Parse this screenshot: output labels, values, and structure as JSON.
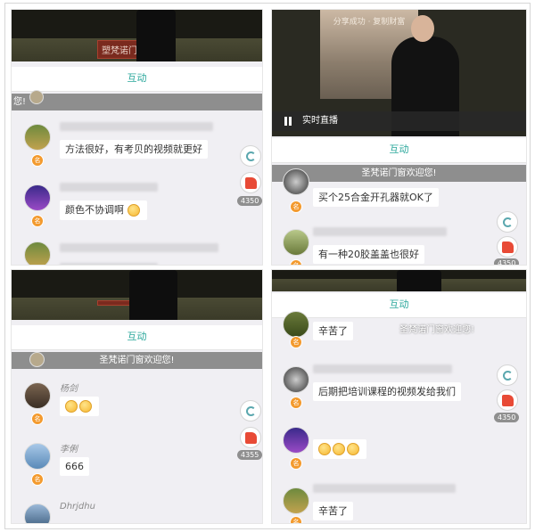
{
  "colors": {
    "accent": "#2aa79b",
    "banner": "#8e8e8e",
    "like": "#e84a36",
    "badge": "#f39a2e"
  },
  "icons": [
    "refresh-icon",
    "thumb-up-icon",
    "pause-icon"
  ],
  "panels": {
    "tl": {
      "tab": "互动",
      "banner": "您!",
      "sign": "塑梵诺门",
      "likes": "4350",
      "messages": [
        {
          "text": "方法很好，有考贝的视频就更好"
        },
        {
          "text": "颜色不协调啊"
        },
        {
          "text": "一一一 一一一"
        }
      ]
    },
    "tr": {
      "screen_caption": "分享成功 · 复制财富",
      "live": "实时直播",
      "tab": "互动",
      "banner": "圣梵诺门窗欢迎您!",
      "likes": "4350",
      "messages": [
        {
          "text": "买个25合金开孔器就OK了"
        },
        {
          "text": "有一种20胶盖盖也很好"
        }
      ]
    },
    "bl": {
      "tab": "互动",
      "banner": "圣梵诺门窗欢迎您!",
      "likes": "4355",
      "messages": [
        {
          "name": "杨剑",
          "text": ""
        },
        {
          "name": "李俐",
          "text": "666"
        },
        {
          "name": "Dhrjdhu",
          "text": ""
        }
      ]
    },
    "br": {
      "tab": "互动",
      "banner": "圣梵诺门窗欢迎您!",
      "likes": "4350",
      "messages": [
        {
          "text": "辛苦了"
        },
        {
          "text": "后期把培训课程的视频发给我们"
        },
        {
          "text": ""
        },
        {
          "text": "辛苦了"
        }
      ]
    }
  }
}
